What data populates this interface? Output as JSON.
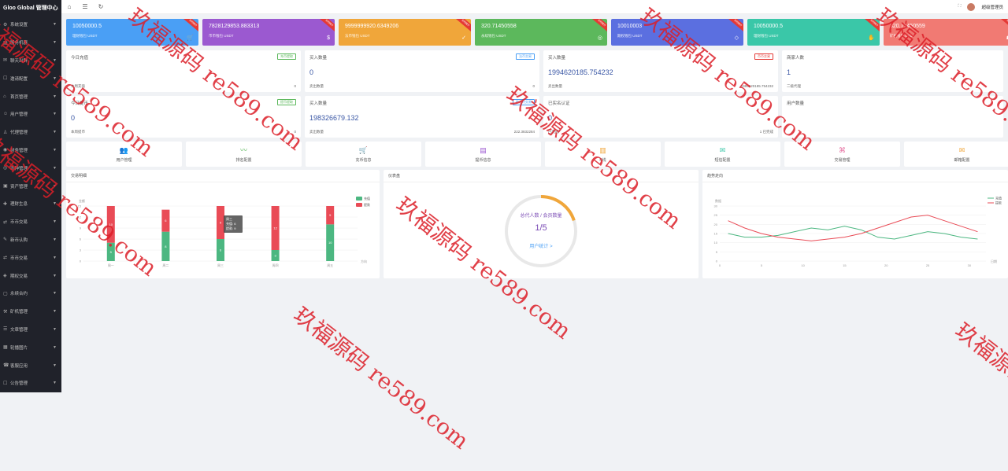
{
  "app": {
    "title": "Gloo Global 管理中心"
  },
  "sidebar": {
    "items": [
      {
        "label": "系统设置",
        "icon": "gear-icon"
      },
      {
        "label": "服务机器",
        "icon": "server-icon"
      },
      {
        "label": "聊天出群",
        "icon": "chat-icon"
      },
      {
        "label": "邀请配置",
        "icon": "invite-icon"
      },
      {
        "label": "首页管理",
        "icon": "home-icon"
      },
      {
        "label": "用户管理",
        "icon": "user-icon"
      },
      {
        "label": "代理管理",
        "icon": "agent-icon"
      },
      {
        "label": "财务管理",
        "icon": "finance-icon"
      },
      {
        "label": "币种管理",
        "icon": "coin-icon"
      },
      {
        "label": "资产管理",
        "icon": "asset-icon"
      },
      {
        "label": "理财生息",
        "icon": "interest-icon"
      },
      {
        "label": "币币交易",
        "icon": "exchange-icon"
      },
      {
        "label": "新币认购",
        "icon": "subscribe-icon"
      },
      {
        "label": "币币交易",
        "icon": "exchange-icon"
      },
      {
        "label": "期权交易",
        "icon": "option-icon"
      },
      {
        "label": "永续合约",
        "icon": "contract-icon"
      },
      {
        "label": "矿机管理",
        "icon": "miner-icon"
      },
      {
        "label": "文章管理",
        "icon": "article-icon"
      },
      {
        "label": "轮播图片",
        "icon": "banner-icon"
      },
      {
        "label": "客服应用",
        "icon": "service-icon"
      },
      {
        "label": "公告管理",
        "icon": "notice-icon"
      }
    ]
  },
  "topbar": {
    "user": "超级管理员"
  },
  "stats": [
    {
      "value": "10050000.5",
      "label": "理财钱包 USDT",
      "color": "#4a9ff5",
      "icon": "cart-icon",
      "ribbon": "实时统计"
    },
    {
      "value": "7828129853.883313",
      "label": "币币钱包 USDT",
      "color": "#9b59d0",
      "icon": "dollar-icon",
      "ribbon": "实时统计"
    },
    {
      "value": "9999999920.6349206",
      "label": "法币钱包 USDT",
      "color": "#f0a63a",
      "icon": "shield-icon",
      "ribbon": "实时统计"
    },
    {
      "value": "320.71450558",
      "label": "永续钱包 USDT",
      "color": "#5cb85c",
      "icon": "target-icon",
      "ribbon": "实时统计"
    },
    {
      "value": "10010003",
      "label": "期权钱包 USDT",
      "color": "#5b6fe0",
      "icon": "diamond-icon",
      "ribbon": "实时统计"
    },
    {
      "value": "10050000.5",
      "label": "理财钱包 USDT",
      "color": "#3ac7a8",
      "icon": "bag-icon",
      "ribbon": "实时统计"
    },
    {
      "value": "320.71450559",
      "label": "矿机钱包 USDT",
      "color": "#f17a73",
      "icon": "gift-icon",
      "ribbon": "实时统计"
    }
  ],
  "cards_row1": [
    {
      "title": "今日充值",
      "tag": "充币提取",
      "tag_color": "#5cb85c",
      "value": "",
      "foot_l": "本周充值",
      "foot_r": "0"
    },
    {
      "title": "买入数量",
      "tag": "法币交易",
      "tag_color": "#4a9ff5",
      "value": "0",
      "foot_l": "卖出数量",
      "foot_r": "0"
    },
    {
      "title": "买入数量",
      "tag": "币币交易",
      "tag_color": "#e53935",
      "value": "1994620185.754232",
      "foot_l": "卖出数量",
      "foot_r": "1994620185.754232"
    },
    {
      "title": "商家人数",
      "tag": "",
      "tag_color": "#999",
      "value": "1",
      "foot_l": "二级代理",
      "foot_r": ""
    }
  ],
  "cards_row2": [
    {
      "title": "今日提币",
      "tag": "提币提取",
      "tag_color": "#5cb85c",
      "value": "0",
      "foot_l": "本周提币",
      "foot_r": "0"
    },
    {
      "title": "买入数量",
      "tag": "秒合约交易",
      "tag_color": "#4a9ff5",
      "value": "198326679.132",
      "foot_l": "卖出数量",
      "foot_r": "222.3832284"
    },
    {
      "title": "已实名认证",
      "tag": "",
      "tag_color": "#e53935",
      "value": "0",
      "foot_l": "已完成",
      "foot_r": "1 已完成"
    },
    {
      "title": "用户数量",
      "tag": "",
      "tag_color": "#999",
      "value": "",
      "foot_l": "",
      "foot_r": ""
    }
  ],
  "quick": [
    {
      "label": "用户管理",
      "icon": "users-icon",
      "color": "#4a9ff5"
    },
    {
      "label": "排名配置",
      "icon": "pulse-icon",
      "color": "#5cb85c"
    },
    {
      "label": "充币信息",
      "icon": "cart-icon",
      "color": "#f17a73"
    },
    {
      "label": "提币信息",
      "icon": "clipboard-icon",
      "color": "#9b59d0"
    },
    {
      "label": "K线",
      "icon": "chart-icon",
      "color": "#f0a63a"
    },
    {
      "label": "短信配置",
      "icon": "mail-icon",
      "color": "#3ac7a8"
    },
    {
      "label": "交易管理",
      "icon": "tag-icon",
      "color": "#e56fa0"
    },
    {
      "label": "邮箱配置",
      "icon": "envelope-icon",
      "color": "#f0a63a"
    }
  ],
  "panels": {
    "left": "交易明细",
    "middle": "仪表盘",
    "right": "趋势走向"
  },
  "gauge": {
    "label": "总代人数 / 会员数量",
    "value": "1/5",
    "link": "用户统计 >",
    "fraction": 0.2
  },
  "chart_data": [
    {
      "type": "bar",
      "categories": [
        "周一",
        "周二",
        "周三",
        "周四",
        "周五"
      ],
      "series": [
        {
          "name": "充值",
          "values": [
            5,
            8,
            6,
            3,
            10
          ],
          "color": "#4cb781"
        },
        {
          "name": "提款",
          "values": [
            10,
            6,
            9,
            12,
            5
          ],
          "color": "#e94b56"
        }
      ],
      "ylabel": "金额",
      "xlabel": "方向",
      "ylim": [
        0,
        15
      ],
      "yticks": [
        0,
        3,
        6,
        9,
        12,
        15
      ],
      "tooltip": {
        "title": "周三",
        "rows": [
          "充值: 6",
          "提款: 9"
        ]
      }
    },
    {
      "type": "line",
      "x": [
        1,
        3,
        5,
        7,
        9,
        11,
        13,
        15,
        17,
        19,
        21,
        23,
        25,
        27,
        29,
        31
      ],
      "series": [
        {
          "name": "充值",
          "values": [
            15,
            13,
            13,
            14,
            16,
            18,
            17,
            19,
            17,
            13,
            12,
            14,
            16,
            15,
            13,
            12
          ],
          "color": "#4cb781"
        },
        {
          "name": "提款",
          "values": [
            22,
            18,
            15,
            13,
            12,
            11,
            12,
            13,
            15,
            18,
            21,
            24,
            25,
            22,
            19,
            16
          ],
          "color": "#e94b56"
        }
      ],
      "ylabel": "数据",
      "xlabel": "日期",
      "ylim": [
        0,
        30
      ],
      "yticks": [
        0,
        5,
        10,
        15,
        20,
        25,
        30
      ],
      "xticks": [
        0,
        5,
        10,
        15,
        20,
        25,
        30
      ]
    }
  ],
  "watermark": "玖福源码 re589.com"
}
